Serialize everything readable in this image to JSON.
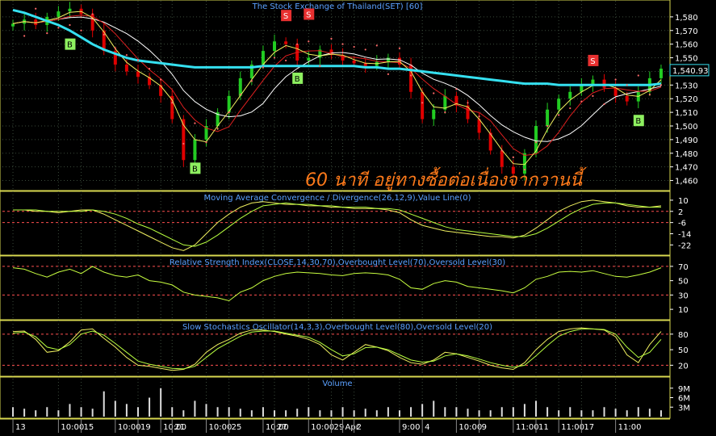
{
  "colors": {
    "background": "#000000",
    "grid": "#3a4a3a",
    "panel_border": "#d8d850",
    "title": "#5aa0ff",
    "axis_text": "#ffffff",
    "candle_up": "#22cc22",
    "candle_down": "#e00000",
    "ma_long": "#35e0f0",
    "ma_white": "#ffffff",
    "ma_yellow": "#f0f060",
    "ma_red": "#e02020",
    "sar": "#ff6a6a",
    "macd": "#f0f060",
    "signal": "#b8ff40",
    "rsi": "#c8ff40",
    "stoch_k": "#f0f060",
    "stoch_d": "#b8ff40",
    "level_line": "#ff5050",
    "volume": "#dddddd",
    "buy_badge": "#8ef060",
    "sell_badge": "#e83030",
    "price_marker": "#35e0f0",
    "annotation": "#ff7a1a"
  },
  "annotation": "60 นาที อยู่ทางซื้อต่อเนื่องจากวานนี้",
  "chart_data": [
    {
      "type": "candlestick",
      "title": "The Stock Exchange of Thailand(SET) [60]",
      "ylim": [
        1455,
        1590
      ],
      "yticks": [
        "1,580",
        "1,570",
        "1,560",
        "1,550",
        "1,540",
        "1,530",
        "1,520",
        "1,510",
        "1,500",
        "1,490",
        "1,480",
        "1,470",
        "1,460"
      ],
      "last_price": "1,540.93",
      "close": [
        1575,
        1578,
        1574,
        1580,
        1584,
        1586,
        1582,
        1570,
        1555,
        1545,
        1540,
        1536,
        1530,
        1522,
        1505,
        1475,
        1490,
        1500,
        1510,
        1522,
        1535,
        1545,
        1555,
        1562,
        1560,
        1548,
        1550,
        1556,
        1552,
        1548,
        1546,
        1544,
        1547,
        1550,
        1545,
        1525,
        1505,
        1512,
        1522,
        1515,
        1505,
        1495,
        1482,
        1470,
        1465,
        1480,
        1500,
        1512,
        1520,
        1525,
        1530,
        1534,
        1528,
        1522,
        1518,
        1525,
        1535,
        1542
      ],
      "ma_long": [
        1585,
        1583,
        1580,
        1577,
        1574,
        1570,
        1565,
        1560,
        1556,
        1553,
        1550,
        1548,
        1547,
        1546,
        1545,
        1544,
        1543,
        1543,
        1543,
        1543,
        1543,
        1543,
        1544,
        1544,
        1544,
        1544,
        1544,
        1544,
        1544,
        1544,
        1544,
        1543,
        1543,
        1542,
        1542,
        1541,
        1540,
        1539,
        1538,
        1537,
        1536,
        1535,
        1534,
        1533,
        1532,
        1531,
        1531,
        1531,
        1530,
        1530,
        1530,
        1530,
        1530,
        1530,
        1530,
        1530,
        1530,
        1531
      ],
      "signals": [
        {
          "label": "B",
          "i": 5,
          "price": 1560
        },
        {
          "label": "B",
          "i": 16,
          "price": 1469
        },
        {
          "label": "S",
          "i": 24,
          "price": 1581
        },
        {
          "label": "S",
          "i": 26,
          "price": 1582
        },
        {
          "label": "B",
          "i": 25,
          "price": 1535
        },
        {
          "label": "S",
          "i": 51,
          "price": 1548
        },
        {
          "label": "B",
          "i": 55,
          "price": 1504
        }
      ]
    },
    {
      "type": "line",
      "title": "Moving Average Convergence / Divergence(26,12,9),Value Line(0)",
      "ylim": [
        -27,
        14
      ],
      "yticks": [
        "10",
        "2",
        "-6",
        "-14",
        "-22"
      ],
      "levels": [
        2,
        -6
      ],
      "series": [
        {
          "values": [
            3,
            3,
            2,
            2,
            1,
            2,
            3,
            3,
            0,
            -4,
            -8,
            -12,
            -16,
            -20,
            -24,
            -26,
            -22,
            -14,
            -6,
            0,
            5,
            8,
            9,
            8,
            7,
            7,
            6,
            6,
            5,
            5,
            4,
            4,
            4,
            3,
            1,
            -4,
            -8,
            -10,
            -12,
            -13,
            -14,
            -15,
            -16,
            -16,
            -17,
            -15,
            -10,
            -4,
            2,
            6,
            9,
            10,
            9,
            8,
            6,
            5,
            5,
            6
          ]
        },
        {
          "values": [
            3,
            3,
            3,
            2,
            2,
            2,
            2,
            3,
            2,
            0,
            -3,
            -7,
            -10,
            -14,
            -18,
            -22,
            -23,
            -20,
            -15,
            -9,
            -3,
            2,
            6,
            7,
            8,
            7,
            7,
            6,
            6,
            5,
            5,
            5,
            4,
            4,
            3,
            0,
            -3,
            -6,
            -9,
            -11,
            -12,
            -13,
            -14,
            -15,
            -16,
            -16,
            -14,
            -10,
            -5,
            0,
            4,
            7,
            8,
            8,
            7,
            6,
            5,
            5
          ]
        }
      ]
    },
    {
      "type": "line",
      "title": "Relative Strength Index(CLOSE,14,30,70),Overbought Level(70),Oversold Level(30)",
      "ylim": [
        0,
        80
      ],
      "yticks": [
        "70",
        "50",
        "30",
        "10"
      ],
      "levels": [
        70,
        30
      ],
      "series": [
        {
          "values": [
            68,
            66,
            60,
            55,
            62,
            66,
            60,
            70,
            62,
            57,
            55,
            58,
            50,
            48,
            44,
            34,
            30,
            28,
            26,
            22,
            34,
            40,
            50,
            56,
            60,
            62,
            61,
            60,
            58,
            57,
            60,
            61,
            60,
            58,
            52,
            40,
            38,
            46,
            50,
            48,
            42,
            40,
            38,
            36,
            33,
            40,
            52,
            56,
            62,
            63,
            62,
            64,
            60,
            56,
            55,
            58,
            62,
            68
          ]
        }
      ]
    },
    {
      "type": "line",
      "title": "Slow Stochastics Oscillator(14,3,3),Overbought Level(80),Oversold Level(20)",
      "ylim": [
        5,
        100
      ],
      "yticks": [
        "80",
        "50",
        "20"
      ],
      "levels": [
        80,
        20
      ],
      "series": [
        {
          "values": [
            85,
            86,
            70,
            45,
            48,
            65,
            88,
            90,
            72,
            55,
            35,
            20,
            18,
            14,
            10,
            12,
            22,
            45,
            60,
            70,
            82,
            88,
            88,
            85,
            80,
            76,
            70,
            60,
            40,
            30,
            45,
            60,
            55,
            48,
            35,
            25,
            22,
            30,
            45,
            42,
            35,
            28,
            20,
            15,
            12,
            25,
            50,
            70,
            85,
            90,
            92,
            90,
            88,
            75,
            40,
            25,
            60,
            85
          ]
        },
        {
          "values": [
            82,
            84,
            75,
            55,
            50,
            60,
            80,
            86,
            78,
            62,
            45,
            28,
            22,
            18,
            14,
            13,
            18,
            35,
            52,
            64,
            76,
            84,
            86,
            86,
            82,
            78,
            74,
            64,
            50,
            38,
            42,
            54,
            55,
            50,
            40,
            30,
            26,
            28,
            38,
            42,
            38,
            32,
            25,
            20,
            16,
            20,
            38,
            58,
            76,
            85,
            90,
            90,
            89,
            80,
            55,
            35,
            45,
            70
          ]
        }
      ]
    },
    {
      "type": "bar",
      "title": "Volume",
      "yticks": [
        "9M",
        "6M",
        "3M"
      ],
      "ylim": [
        0,
        12
      ],
      "values": [
        3,
        2.5,
        2,
        3,
        2,
        4,
        3,
        2.5,
        8,
        5,
        4,
        3,
        6,
        9,
        3,
        2,
        5,
        4,
        3,
        3,
        2.5,
        2,
        3,
        2,
        2,
        2.5,
        3,
        2,
        2,
        3,
        2,
        2.5,
        2,
        3,
        2,
        3,
        4,
        5,
        3,
        3,
        2.5,
        2,
        2,
        3,
        3,
        4,
        5,
        3,
        2,
        3,
        2,
        2,
        3,
        2.5,
        2,
        3,
        2.5,
        2
      ]
    }
  ],
  "x_labels": [
    {
      "text": "13",
      "i": 0
    },
    {
      "text": "10:00",
      "i": 4
    },
    {
      "text": "15",
      "i": 6
    },
    {
      "text": "10:00",
      "i": 9
    },
    {
      "text": "19",
      "i": 11
    },
    {
      "text": "10:00",
      "i": 13
    },
    {
      "text": "21",
      "i": 14
    },
    {
      "text": "10:00",
      "i": 17
    },
    {
      "text": "25",
      "i": 19
    },
    {
      "text": "10:00",
      "i": 22
    },
    {
      "text": "27",
      "i": 23
    },
    {
      "text": "10:00",
      "i": 26
    },
    {
      "text": "29",
      "i": 28
    },
    {
      "text": "Apr",
      "i": 29
    },
    {
      "text": "2",
      "i": 30
    },
    {
      "text": "9:00",
      "i": 34
    },
    {
      "text": "4",
      "i": 36
    },
    {
      "text": "10:00",
      "i": 39
    },
    {
      "text": "9",
      "i": 41
    },
    {
      "text": "11:00",
      "i": 44
    },
    {
      "text": "11",
      "i": 46
    },
    {
      "text": "11:00",
      "i": 48
    },
    {
      "text": "17",
      "i": 50
    },
    {
      "text": "11:00",
      "i": 53
    }
  ]
}
